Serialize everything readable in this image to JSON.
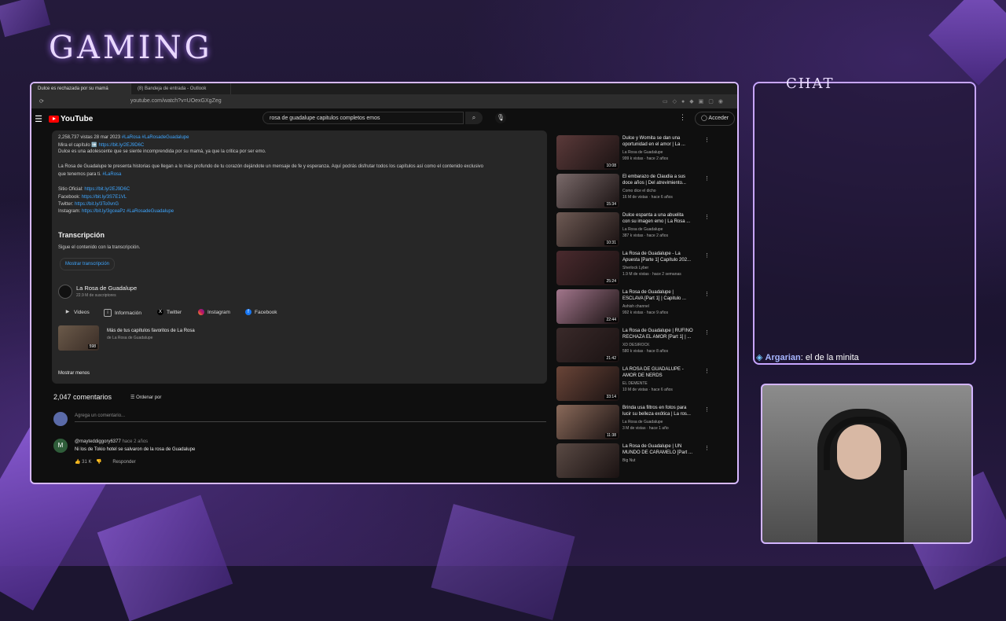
{
  "overlay": {
    "title": "GAMING",
    "chat_label": "CHAT",
    "chat_message": {
      "user": "Argarian",
      "text": ": el de la minita"
    }
  },
  "browser": {
    "tabs": [
      "Dulce es rechazada por su mamá",
      "(8) Bandeja de entrada - Outlook"
    ],
    "url": "youtube.com/watch?v=UOexGXgZeg"
  },
  "youtube": {
    "logo": "YouTube",
    "search_value": "rosa de guadalupe capitulos completos emos",
    "sign_in": "Acceder",
    "description": {
      "stats": "2,258,737 vistas  28 mar 2023",
      "stats_tags": "#LaRosa #LaRosadeGuadalupe",
      "line_mira": "Mira el capítulo ➡️",
      "mira_link": "https://bit.ly/2EJ9D6C",
      "summary": "Dulce es una adolescente que se siente incomprendida por su mamá, ya que la critica por ser emo.",
      "para1": "La Rosa de Guadalupe te presenta historias que llegan a lo más profundo de tu corazón dejándote un mensaje de fe y esperanza. Aquí podrás disfrutar todos los capítulos así como el contenido exclusivo",
      "para2": "que tenemos para ti.",
      "para2_tag": "#LaRosa",
      "links": [
        {
          "label": "Sitio Oficial:",
          "url": "https://bit.ly/2EJ9D6C"
        },
        {
          "label": "Facebook:",
          "url": "https://bit.ly/3S7E1VL"
        },
        {
          "label": "Twitter:",
          "url": "https://bit.ly/3To0vnG"
        },
        {
          "label": "Instagram:",
          "url": "https://bit.ly/3gceaPz  #LaRosadeGuadalupe"
        }
      ],
      "transcript_heading": "Transcripción",
      "transcript_sub": "Sigue el contenido con la transcripción.",
      "transcript_button": "Mostrar transcripción",
      "channel_name": "La Rosa de Guadalupe",
      "channel_subs": "22.9 M de suscriptores",
      "chips": [
        "Videos",
        "Información",
        "Twitter",
        "Instagram",
        "Facebook"
      ],
      "playlist_title": "Más de tus capítulos favoritos de La Rosa",
      "playlist_channel": "de La Rosa de Guadalupe",
      "playlist_count": "598",
      "show_less": "Mostrar menos"
    },
    "comments": {
      "count": "2,047 comentarios",
      "sort": "Ordenar por",
      "add_placeholder": "Agrega un comentario...",
      "first": {
        "author": "@mayteddiggory6377",
        "time": "hace 2 años",
        "text": "Ni los de Tokio hotel se salvaron de la rosa de Guadalupe",
        "likes": "31 K",
        "reply": "Responder",
        "avatar_letter": "M"
      }
    },
    "related": [
      {
        "title1": "Dulce y Womita se dan una",
        "title2": "oportunidad en el amor | La ...",
        "channel": "La Rosa de Guadalupe",
        "meta": "999 k vistas · hace 2 años",
        "duration": "10:08",
        "color": "#5b3a3a"
      },
      {
        "title1": "El embarazo de Claudia a sus",
        "title2": "doce años | Del atrevimiento...",
        "channel": "Como dice el dicho",
        "meta": "16 M de vistas · hace 6 años",
        "duration": "15:34",
        "color": "#7a6a6a"
      },
      {
        "title1": "Dulce espanta a una abuelita",
        "title2": "con su imagen emo | La Rosa ...",
        "channel": "La Rosa de Guadalupe",
        "meta": "387 k vistas · hace 2 años",
        "duration": "10:31",
        "color": "#6e5a54"
      },
      {
        "title1": "La Rosa de Guadalupe - La",
        "title2": "Apuesta [Parte 1] Capítulo 202...",
        "channel": "Sherlock Lyber",
        "meta": "1.9 M de vistas · hace 2 semanas",
        "duration": "25:24",
        "color": "#4a2a2e"
      },
      {
        "title1": "La Rosa de Guadalupe |",
        "title2": "ESCLAVA [Part 1] | Capitulo ...",
        "channel": "Ashish channel",
        "meta": "992 k vistas · hace 9 años",
        "duration": "22:44",
        "color": "#a2768c"
      },
      {
        "title1": "La Rosa de Guadalupe | RUFINO",
        "title2": "RECHAZA EL AMOR [Part 1] | ...",
        "channel": "XD DESIROCK",
        "meta": "580 k vistas · hace 8 años",
        "duration": "21:42",
        "color": "#3a2a2a"
      },
      {
        "title1": "LA ROSA DE GUADALUPE -",
        "title2": "AMOR DE NERDS",
        "channel": "EL DEMENTE",
        "meta": "10 M de vistas · hace 6 años",
        "duration": "33:14",
        "color": "#6a4538"
      },
      {
        "title1": "Brinda usa filtros en fotos para",
        "title2": "lucir su belleza exótica | La ros...",
        "channel": "La Rosa de Guadalupe",
        "meta": "3 M de vistas · hace 1 año",
        "duration": "11:38",
        "color": "#8a6a5a"
      },
      {
        "title1": "La Rosa de Guadalupe | UN",
        "title2": "MUNDO DE CARAMELO [Part ...",
        "channel": "Big Nut",
        "meta": "",
        "duration": "",
        "color": "#5a4a44"
      }
    ]
  }
}
